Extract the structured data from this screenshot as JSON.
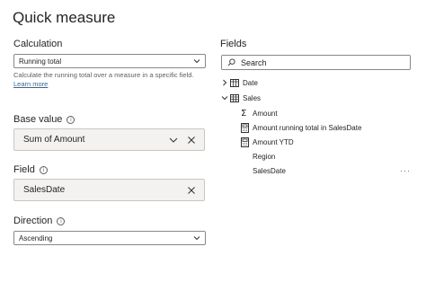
{
  "dialog": {
    "title": "Quick measure"
  },
  "calculation": {
    "label": "Calculation",
    "selected": "Running total",
    "description": "Calculate the running total over a measure in a specific field.",
    "learn_more": "Learn more"
  },
  "base_value": {
    "label": "Base value",
    "value": "Sum of Amount"
  },
  "field": {
    "label": "Field",
    "value": "SalesDate"
  },
  "direction": {
    "label": "Direction",
    "selected": "Ascending"
  },
  "fields_pane": {
    "label": "Fields",
    "search_placeholder": "Search",
    "tables": [
      {
        "name": "Date",
        "expanded": false
      },
      {
        "name": "Sales",
        "expanded": true,
        "columns": [
          {
            "name": "Amount",
            "icon": "sigma-icon"
          },
          {
            "name": "Amount running total in SalesDate",
            "icon": "calculator-icon"
          },
          {
            "name": "Amount YTD",
            "icon": "calculator-icon"
          },
          {
            "name": "Region",
            "icon": "none"
          },
          {
            "name": "SalesDate",
            "icon": "none",
            "more": "···"
          }
        ]
      }
    ]
  },
  "colors": {
    "link": "#1170c4",
    "border": "#8a8886",
    "well_bg": "#f3f2f1"
  }
}
